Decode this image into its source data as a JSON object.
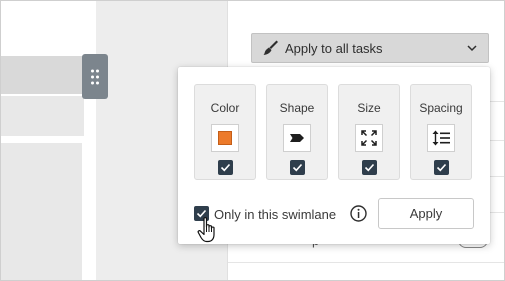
{
  "toolbar": {
    "apply_all_label": "Apply to all tasks",
    "brush_icon": "paintbrush-icon",
    "dropdown_icon": "chevron-down-icon"
  },
  "popover": {
    "options": [
      {
        "label": "Color",
        "icon": "color-swatch-icon",
        "swatch_color": "#ec7a2a",
        "checked": true
      },
      {
        "label": "Shape",
        "icon": "shape-tag-icon",
        "checked": true
      },
      {
        "label": "Size",
        "icon": "expand-arrows-icon",
        "checked": true
      },
      {
        "label": "Spacing",
        "icon": "line-spacing-icon",
        "checked": true
      }
    ],
    "swimlane_checkbox_label": "Only in this swimlane",
    "swimlane_checked": true,
    "info_icon": "info-icon",
    "apply_label": "Apply"
  },
  "background": {
    "partial_text": "p"
  },
  "colors": {
    "checkbox": "#2f3e4c",
    "handle": "#7c858d",
    "swatch": "#ec7a2a"
  }
}
